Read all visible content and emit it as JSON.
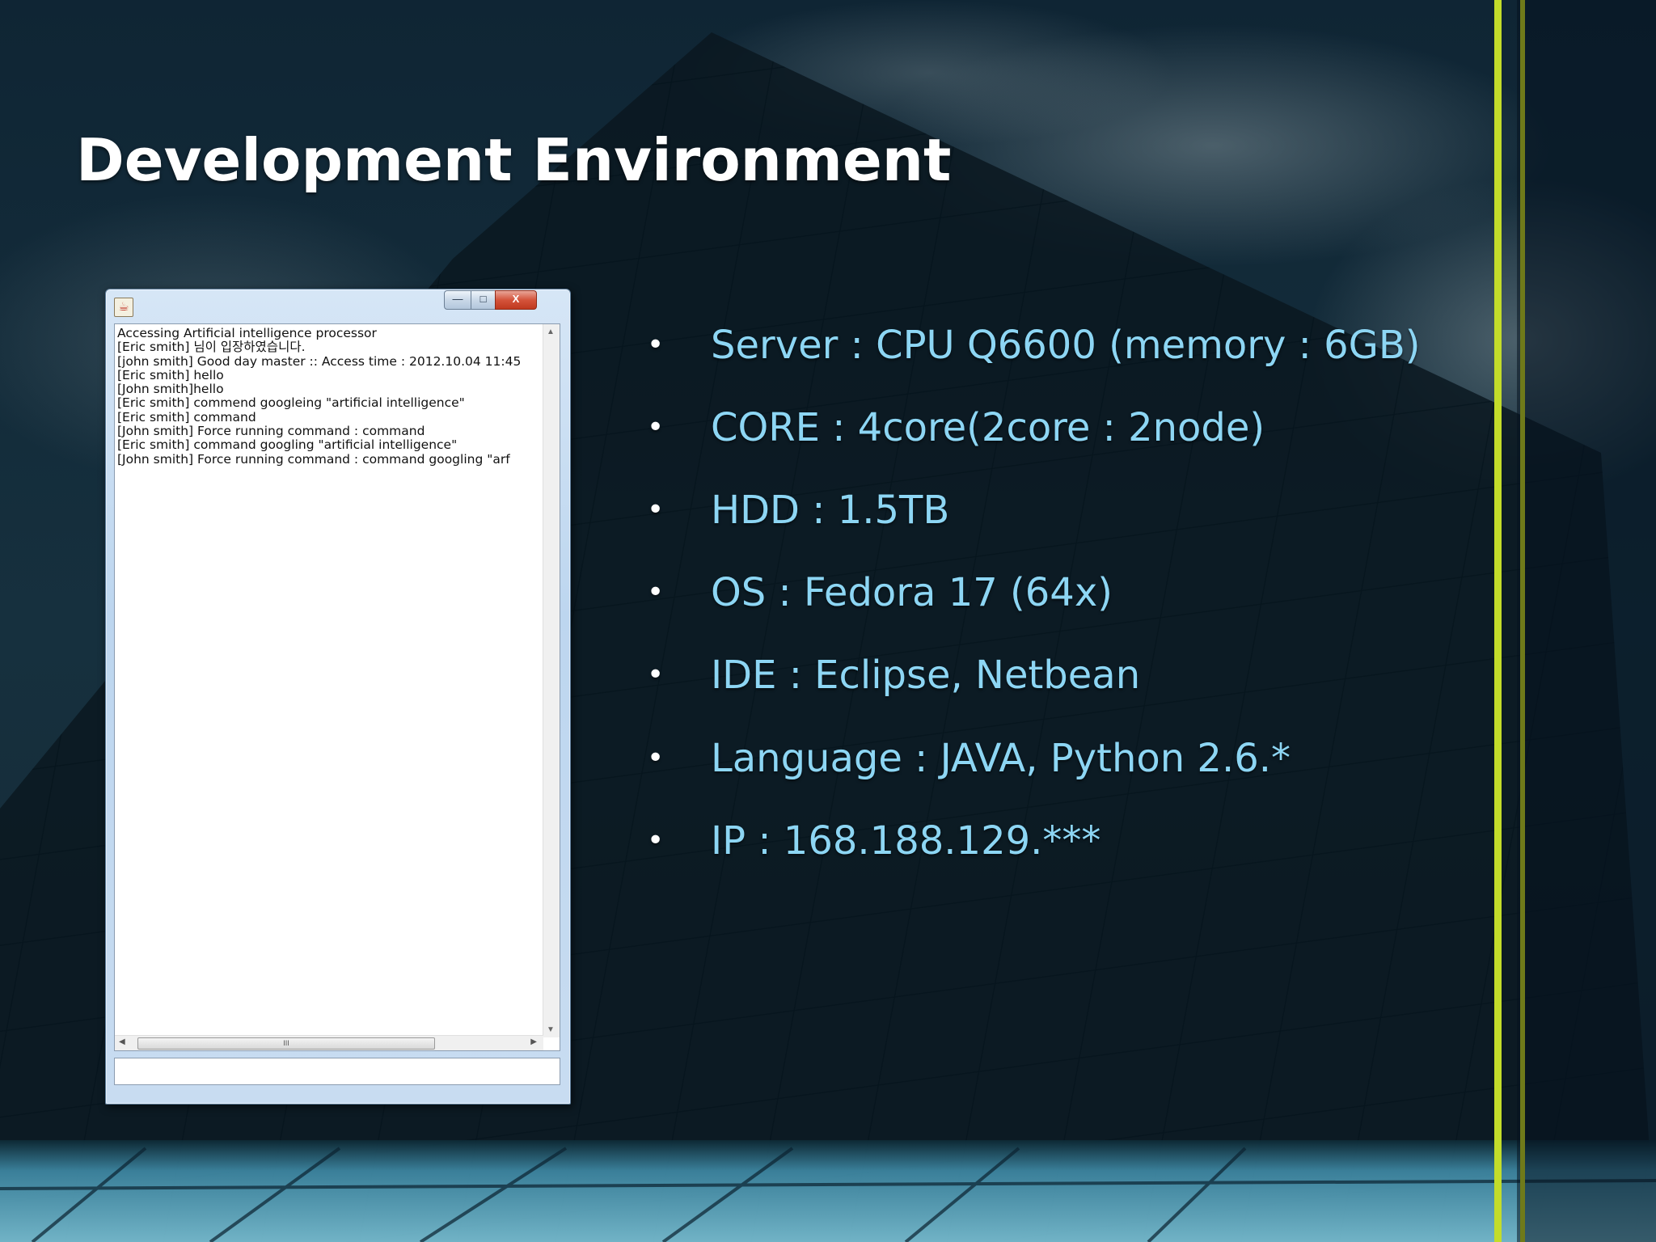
{
  "slide": {
    "title": "Development Environment",
    "accent_color": "#c3dc2a",
    "text_color": "#8dd6f4",
    "bullets": [
      "Server : CPU Q6600 (memory : 6GB)",
      "CORE : 4core(2core : 2node)",
      "HDD : 1.5TB",
      "OS : Fedora 17 (64x)",
      "IDE : Eclipse, Netbean",
      "Language : JAVA, Python 2.6.*",
      "IP : 168.188.129.***"
    ]
  },
  "window": {
    "title": "",
    "icon": "java-cup-icon",
    "controls": {
      "minimize": "—",
      "maximize": "□",
      "close": "X"
    },
    "log_lines": [
      "Accessing Artificial intelligence processor",
      "[Eric smith] 님이 입장하였습니다.",
      "[john smith] Good day master :: Access time : 2012.10.04 11:45",
      "[Eric smith] hello",
      "[John smith]hello",
      "[Eric smith] commend googleing \"artificial intelligence\"",
      "[Eric smith] command",
      "[John smith] Force running command : command",
      "[Eric smith] command googling \"artificial intelligence\"",
      "[John smith] Force running command : command googling \"arf"
    ],
    "scroll_thumb_grip": "III",
    "input_value": ""
  }
}
